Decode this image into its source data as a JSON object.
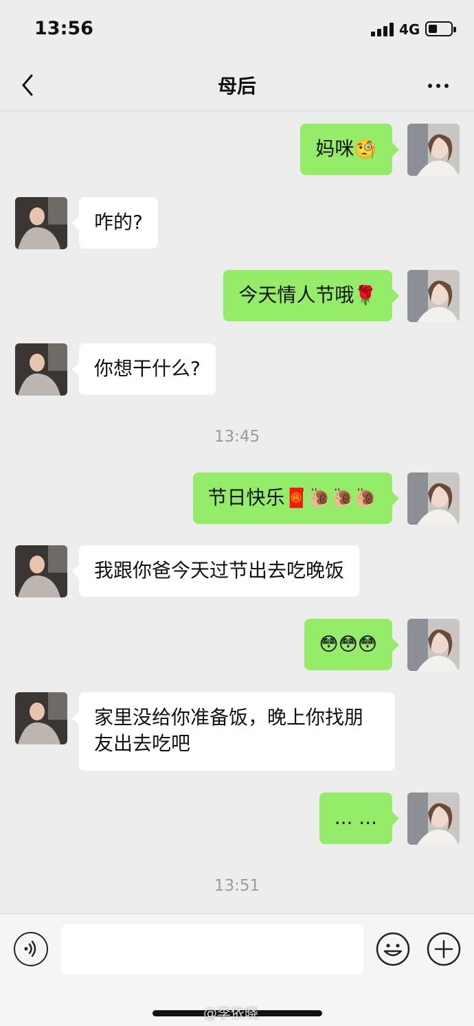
{
  "status_bar": {
    "time": "13:56",
    "network": "4G",
    "battery_level": 0.35
  },
  "nav": {
    "title": "母后",
    "back_icon": "chevron-left-icon",
    "more_icon": "more-dots-icon"
  },
  "colors": {
    "outgoing_bubble": "#95ec69",
    "incoming_bubble": "#ffffff",
    "background": "#ededed",
    "timestamp": "#9b9b9b"
  },
  "messages": [
    {
      "from": "me",
      "text": "妈咪",
      "emoji": "🧐"
    },
    {
      "from": "mom",
      "text": "咋的?"
    },
    {
      "from": "me",
      "text": "今天情人节哦",
      "emoji": "🌹"
    },
    {
      "from": "mom",
      "text": "你想干什么?"
    },
    {
      "type": "time",
      "text": "13:45"
    },
    {
      "from": "me",
      "text": "节日快乐",
      "emoji": "🧧🐌🐌🐌"
    },
    {
      "from": "mom",
      "text": "我跟你爸今天过节出去吃晚饭"
    },
    {
      "from": "me",
      "text": "",
      "emoji": "😳😳😳"
    },
    {
      "from": "mom",
      "text": "家里没给你准备饭，晚上你找朋友出去吃吧"
    },
    {
      "from": "me",
      "text": "... ..."
    },
    {
      "type": "time",
      "text": "13:51"
    }
  ],
  "input_bar": {
    "voice_icon": "voice-icon",
    "emoji_icon": "smiley-icon",
    "plus_icon": "plus-circle-icon",
    "watermark": "@李依晓"
  }
}
